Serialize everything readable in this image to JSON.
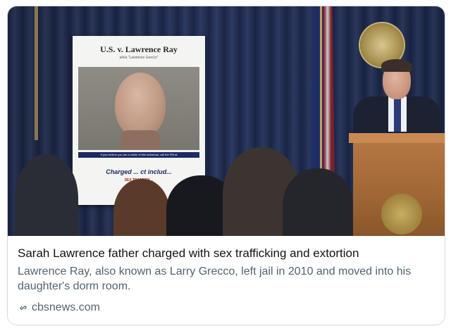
{
  "link_card": {
    "image": {
      "icon": "press-conference-photo",
      "poster": {
        "title": "U.S. v. Lawrence Ray",
        "aka": "a/k/a \"Lawrence Grecco\"",
        "banner": "If you believe you are a victim of this individual, call the FBI at",
        "charged_text": "Charged ... ct includ...",
        "trafficking_text": "SEX TRAFFICK..."
      }
    },
    "headline": "Sarah Lawrence father charged with sex trafficking and extortion",
    "description": "Lawrence Ray, also known as Larry Grecco, left jail in 2010 and moved into his daughter's dorm room.",
    "source": {
      "icon": "link-icon",
      "domain": "cbsnews.com"
    }
  }
}
